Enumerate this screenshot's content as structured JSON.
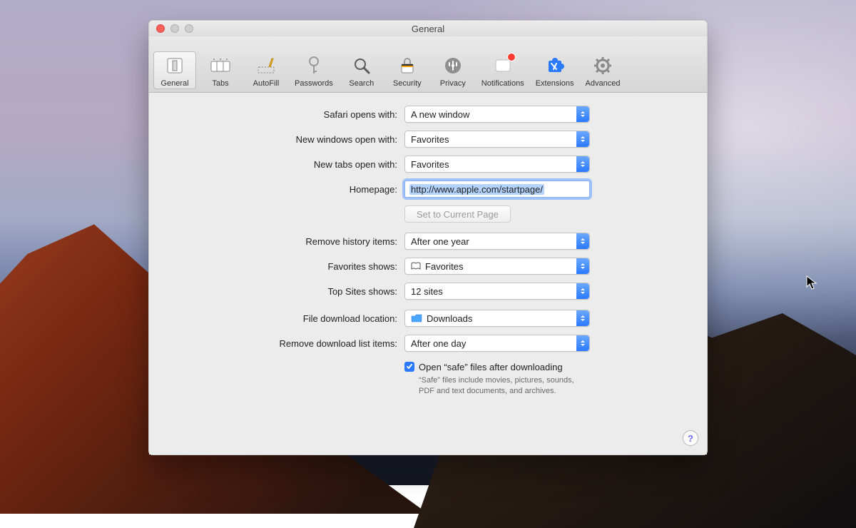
{
  "window": {
    "title": "General"
  },
  "toolbar": {
    "items": [
      {
        "label": "General"
      },
      {
        "label": "Tabs"
      },
      {
        "label": "AutoFill"
      },
      {
        "label": "Passwords"
      },
      {
        "label": "Search"
      },
      {
        "label": "Security"
      },
      {
        "label": "Privacy"
      },
      {
        "label": "Notifications"
      },
      {
        "label": "Extensions"
      },
      {
        "label": "Advanced"
      }
    ]
  },
  "form": {
    "safari_opens_label": "Safari opens with:",
    "safari_opens_value": "A new window",
    "new_windows_label": "New windows open with:",
    "new_windows_value": "Favorites",
    "new_tabs_label": "New tabs open with:",
    "new_tabs_value": "Favorites",
    "homepage_label": "Homepage:",
    "homepage_value": "http://www.apple.com/startpage/",
    "set_current_label": "Set to Current Page",
    "remove_history_label": "Remove history items:",
    "remove_history_value": "After one year",
    "favorites_shows_label": "Favorites shows:",
    "favorites_shows_value": "Favorites",
    "top_sites_label": "Top Sites shows:",
    "top_sites_value": "12 sites",
    "download_loc_label": "File download location:",
    "download_loc_value": "Downloads",
    "remove_downloads_label": "Remove download list items:",
    "remove_downloads_value": "After one day",
    "safe_checkbox_label": "Open “safe” files after downloading",
    "safe_sub": "“Safe” files include movies, pictures, sounds, PDF and text documents, and archives."
  },
  "help": "?"
}
